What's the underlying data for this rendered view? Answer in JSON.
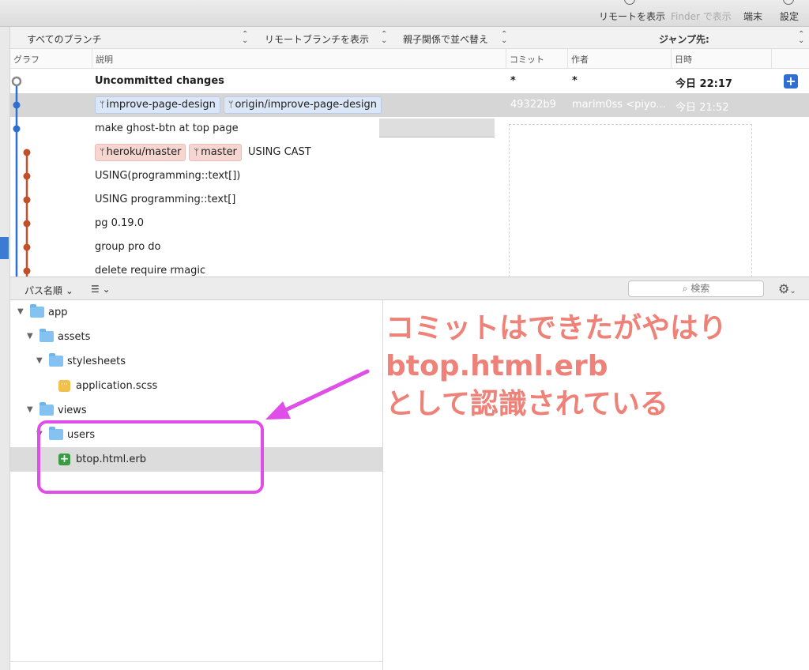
{
  "toolbar": {
    "show_remote": "リモートを表示",
    "show_in_finder": "Finder で表示",
    "terminal": "端末",
    "settings": "設定"
  },
  "filter_bar": {
    "branches": "すべてのブランチ",
    "show_remote_branches": "リモートブランチを表示",
    "sort_order": "親子関係で並べ替え",
    "jump_to": "ジャンプ先:"
  },
  "columns": {
    "graph": "グラフ",
    "description": "説明",
    "commit": "コミット",
    "author": "作者",
    "date": "日時"
  },
  "commits": [
    {
      "description": "Uncommitted changes",
      "commit": "*",
      "author": "*",
      "date": "今日 22:17"
    },
    {
      "tags": [
        "improve-page-design",
        "origin/improve-page-design"
      ],
      "description": "",
      "commit": "49322b9",
      "author": "marim0ss <piyo...",
      "date": "今日 21:52"
    },
    {
      "description": "make ghost-btn at top page"
    },
    {
      "tags": [
        "heroku/master",
        "master"
      ],
      "description": "USING CAST"
    },
    {
      "description": "USING(programming::text[])"
    },
    {
      "description": "USING programming::text[]"
    },
    {
      "description": "pg 0.19.0"
    },
    {
      "description": "group pro do"
    },
    {
      "description": "delete require rmagic"
    }
  ],
  "file_toolbar": {
    "sort": "パス名順",
    "search_placeholder": "検索"
  },
  "file_tree": [
    {
      "name": "app",
      "type": "folder",
      "depth": 0,
      "expanded": true
    },
    {
      "name": "assets",
      "type": "folder",
      "depth": 1,
      "expanded": true
    },
    {
      "name": "stylesheets",
      "type": "folder",
      "depth": 2,
      "expanded": true
    },
    {
      "name": "application.scss",
      "type": "modified",
      "depth": 3
    },
    {
      "name": "views",
      "type": "folder",
      "depth": 1,
      "expanded": true
    },
    {
      "name": "users",
      "type": "folder",
      "depth": 2,
      "expanded": true
    },
    {
      "name": "btop.html.erb",
      "type": "added",
      "depth": 3,
      "selected": true
    }
  ],
  "annotation": {
    "line1": "コミットはできたがやはり",
    "line2": "btop.html.erb",
    "line3": "として認識されている"
  },
  "colors": {
    "accent_blue": "#2f6fd0",
    "annotation": "#ee8278",
    "highlight_magenta": "#e04ee8",
    "graph_blue": "#2f6fd0",
    "graph_orange": "#c0502a"
  }
}
